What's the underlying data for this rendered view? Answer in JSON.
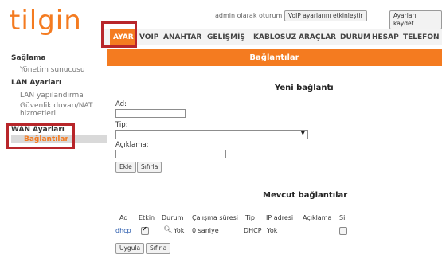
{
  "header": {
    "logo": "tilgin",
    "session_text": "admin olarak oturum açtınız",
    "voip_button": "VoIP ayarlarını etkinleştir",
    "save_button": "Ayarları kaydet"
  },
  "nav": [
    {
      "label": "AYAR",
      "active": true
    },
    {
      "label": "VOIP"
    },
    {
      "label": "ANAHTAR"
    },
    {
      "label": "GELİŞMİŞ"
    },
    {
      "label": "KABLOSUZ"
    },
    {
      "label": "ARAÇLAR"
    },
    {
      "label": "DURUM"
    },
    {
      "label": "HESAP"
    },
    {
      "label": "TELEFON"
    }
  ],
  "sidebar": {
    "items": [
      {
        "label": "Sağlama"
      },
      {
        "label": "Yönetim sunucusu"
      },
      {
        "label": "LAN Ayarları"
      },
      {
        "label": "LAN yapılandırma"
      },
      {
        "label": "Güvenlik duvarı/NAT"
      },
      {
        "label": "hizmetleri"
      },
      {
        "label": "WAN Ayarları"
      },
      {
        "label": "Bağlantılar"
      }
    ]
  },
  "page": {
    "title": "Bağlantılar",
    "new_section": "Yeni bağlantı",
    "fields": {
      "name_label": "Ad:",
      "type_label": "Tip:",
      "desc_label": "Açıklama:"
    },
    "add_button": "Ekle",
    "reset_button": "Sıfırla",
    "existing_section": "Mevcut bağlantılar",
    "table": {
      "headers": [
        "Ad",
        "Etkin",
        "Durum",
        "Çalışma süresi",
        "Tip",
        "IP adresi",
        "Açıklama",
        "Sil"
      ],
      "rows": [
        {
          "name": "dhcp",
          "enabled": true,
          "status": "Yok",
          "uptime": "0 saniye",
          "type": "DHCP",
          "ip": "Yok",
          "desc": "",
          "delete": false
        }
      ]
    },
    "apply_button": "Uygula",
    "reset2_button": "Sıfırla"
  },
  "colors": {
    "accent": "#f47b20",
    "highlight": "#b8262a"
  }
}
